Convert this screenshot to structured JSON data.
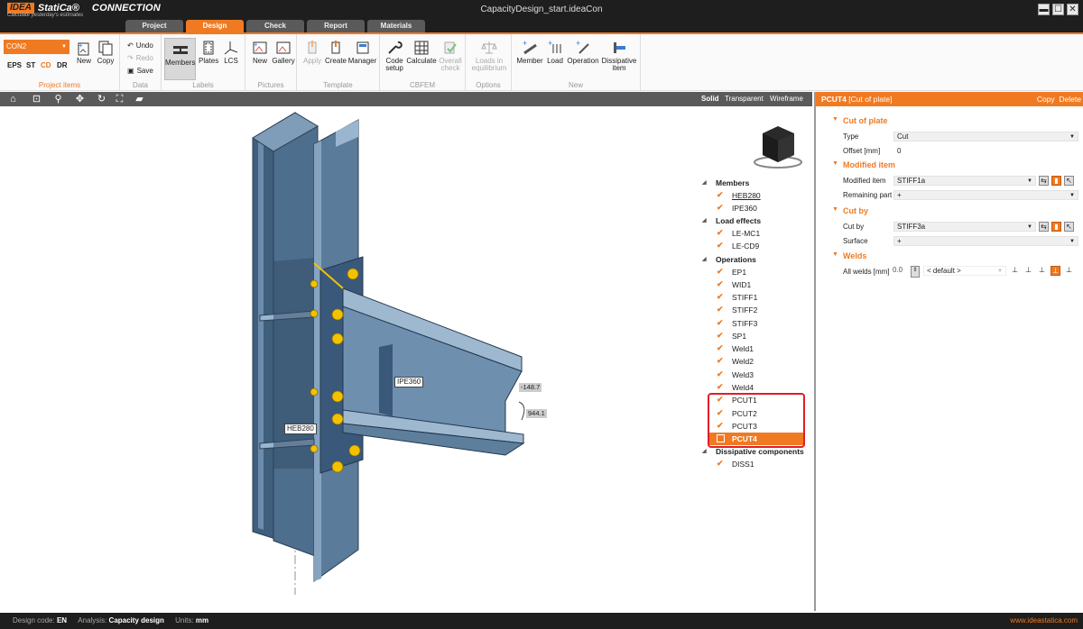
{
  "titlebar": {
    "brand_idea": "IDEA",
    "brand_statica": "StatiCa®",
    "product": "CONNECTION",
    "tagline": "Calculate yesterday's estimates",
    "file_title": "CapacityDesign_start.ideaCon",
    "win_min": "▬",
    "win_max": "☐",
    "win_close": "✕"
  },
  "tabs": [
    "Project",
    "Design",
    "Check",
    "Report",
    "Materials"
  ],
  "active_tab": "Design",
  "ribbon": {
    "project_items": {
      "connection": "CON2",
      "types": [
        "EPS",
        "ST",
        "CD",
        "DR"
      ],
      "selected_type": "CD",
      "new": "New",
      "copy": "Copy",
      "title": "Project items"
    },
    "data": {
      "undo": "Undo",
      "redo": "Redo",
      "save": "Save",
      "title": "Data"
    },
    "labels": {
      "members": "Members",
      "plates": "Plates",
      "lcs": "LCS",
      "title": "Labels"
    },
    "pictures": {
      "new": "New",
      "gallery": "Gallery",
      "title": "Pictures"
    },
    "template": {
      "apply": "Apply",
      "create": "Create",
      "manager": "Manager",
      "title": "Template"
    },
    "cbfem": {
      "code_setup_1": "Code",
      "code_setup_2": "setup",
      "calculate": "Calculate",
      "overall_1": "Overall",
      "overall_2": "check",
      "title": "CBFEM"
    },
    "options": {
      "loads_1": "Loads in",
      "loads_2": "equilibrium",
      "title": "Options"
    },
    "new": {
      "member": "Member",
      "load": "Load",
      "operation": "Operation",
      "dissipative_1": "Dissipative",
      "dissipative_2": "item",
      "title": "New"
    }
  },
  "view_modes": [
    "Solid",
    "Transparent",
    "Wireframe"
  ],
  "active_view_mode": "Solid",
  "model_labels": {
    "column": "HEB280",
    "beam": "IPE360",
    "dim1": "-148.7",
    "dim2": "944.1"
  },
  "tree": {
    "groups": [
      {
        "label": "Members",
        "items": [
          "HEB280",
          "IPE360"
        ]
      },
      {
        "label": "Load effects",
        "items": [
          "LE-MC1",
          "LE-CD9"
        ]
      },
      {
        "label": "Operations",
        "items": [
          "EP1",
          "WID1",
          "STIFF1",
          "STIFF2",
          "STIFF3",
          "SP1",
          "Weld1",
          "Weld2",
          "Weld3",
          "Weld4",
          "PCUT1",
          "PCUT2",
          "PCUT3",
          "PCUT4"
        ]
      },
      {
        "label": "Dissipative components",
        "items": [
          "DISS1"
        ]
      }
    ],
    "selected": "PCUT4"
  },
  "properties": {
    "header_name": "PCUT4",
    "header_sub": "[Cut of plate]",
    "copy": "Copy",
    "delete": "Delete",
    "cut_of_plate": {
      "title": "Cut of plate",
      "type_label": "Type",
      "type_value": "Cut",
      "offset_label": "Offset [mm]",
      "offset_value": "0"
    },
    "modified_item": {
      "title": "Modified item",
      "item_label": "Modified item",
      "item_value": "STIFF1a",
      "remaining_label": "Remaining part",
      "remaining_value": "+"
    },
    "cut_by": {
      "title": "Cut by",
      "cut_label": "Cut by",
      "cut_value": "STIFF3a",
      "surface_label": "Surface",
      "surface_value": "+"
    },
    "welds": {
      "title": "Welds",
      "all_label": "All welds [mm]",
      "all_value": "0.0",
      "default_value": "< default >"
    }
  },
  "status": {
    "design_code_label": "Design code:",
    "design_code": "EN",
    "analysis_label": "Analysis:",
    "analysis": "Capacity design",
    "units_label": "Units:",
    "units": "mm",
    "website": "www.ideastatica.com"
  },
  "colors": {
    "accent": "#f07a22",
    "highlight": "#e01e25",
    "steel": "#5d7f9c",
    "bolt": "#f2c200"
  }
}
